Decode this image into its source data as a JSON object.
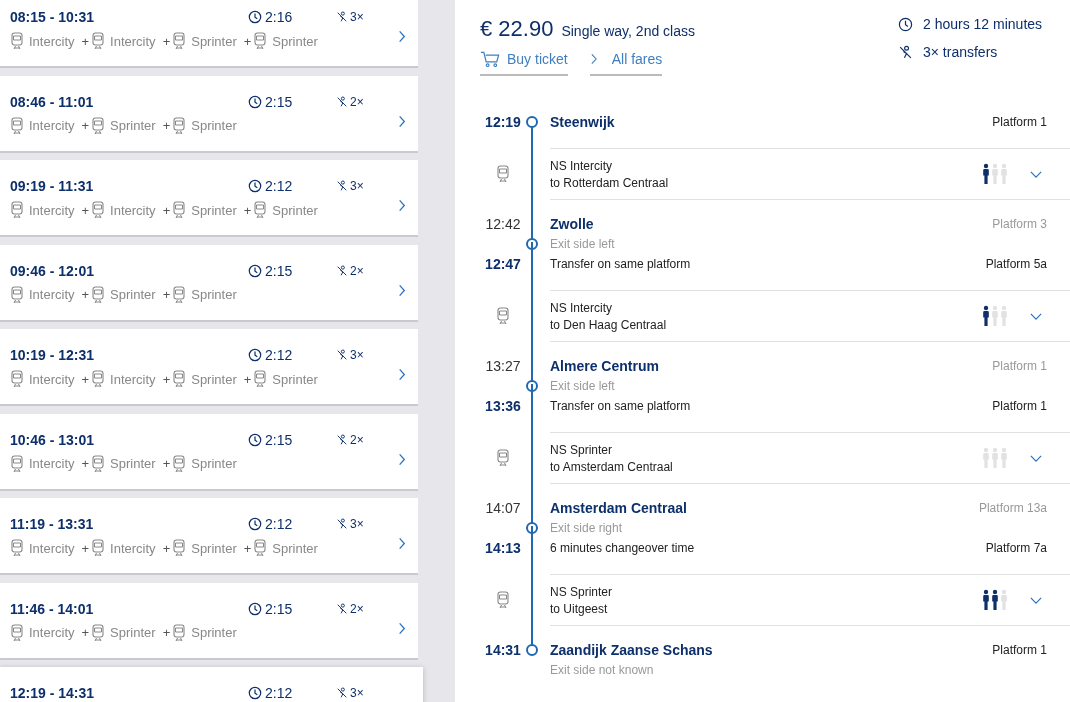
{
  "journeys": [
    {
      "time": "08:15 - 10:31",
      "duration": "2:16",
      "transfers": "3×",
      "selected": false,
      "trains": [
        {
          "name": "Intercity"
        },
        {
          "prefix": "+",
          "name": "Intercity"
        },
        {
          "prefix": "+",
          "name": "Sprinter"
        },
        {
          "prefix": "+",
          "name": "Sprinter"
        }
      ]
    },
    {
      "time": "08:46 - 11:01",
      "duration": "2:15",
      "transfers": "2×",
      "selected": false,
      "trains": [
        {
          "name": "Intercity"
        },
        {
          "prefix": "+",
          "name": "Sprinter"
        },
        {
          "prefix": "+",
          "name": "Sprinter"
        }
      ]
    },
    {
      "time": "09:19 - 11:31",
      "duration": "2:12",
      "transfers": "3×",
      "selected": false,
      "trains": [
        {
          "name": "Intercity"
        },
        {
          "prefix": "+",
          "name": "Intercity"
        },
        {
          "prefix": "+",
          "name": "Sprinter"
        },
        {
          "prefix": "+",
          "name": "Sprinter"
        }
      ]
    },
    {
      "time": "09:46 - 12:01",
      "duration": "2:15",
      "transfers": "2×",
      "selected": false,
      "trains": [
        {
          "name": "Intercity"
        },
        {
          "prefix": "+",
          "name": "Sprinter"
        },
        {
          "prefix": "+",
          "name": "Sprinter"
        }
      ]
    },
    {
      "time": "10:19 - 12:31",
      "duration": "2:12",
      "transfers": "3×",
      "selected": false,
      "trains": [
        {
          "name": "Intercity"
        },
        {
          "prefix": "+",
          "name": "Intercity"
        },
        {
          "prefix": "+",
          "name": "Sprinter"
        },
        {
          "prefix": "+",
          "name": "Sprinter"
        }
      ]
    },
    {
      "time": "10:46 - 13:01",
      "duration": "2:15",
      "transfers": "2×",
      "selected": false,
      "trains": [
        {
          "name": "Intercity"
        },
        {
          "prefix": "+",
          "name": "Sprinter"
        },
        {
          "prefix": "+",
          "name": "Sprinter"
        }
      ]
    },
    {
      "time": "11:19 - 13:31",
      "duration": "2:12",
      "transfers": "3×",
      "selected": false,
      "trains": [
        {
          "name": "Intercity"
        },
        {
          "prefix": "+",
          "name": "Intercity"
        },
        {
          "prefix": "+",
          "name": "Sprinter"
        },
        {
          "prefix": "+",
          "name": "Sprinter"
        }
      ]
    },
    {
      "time": "11:46 - 14:01",
      "duration": "2:15",
      "transfers": "2×",
      "selected": false,
      "trains": [
        {
          "name": "Intercity"
        },
        {
          "prefix": "+",
          "name": "Sprinter"
        },
        {
          "prefix": "+",
          "name": "Sprinter"
        }
      ]
    },
    {
      "time": "12:19 - 14:31",
      "duration": "2:12",
      "transfers": "3×",
      "selected": true
    }
  ],
  "detail": {
    "price": "€ 22.90",
    "fare_type": "Single way, 2nd class",
    "duration": "2 hours 12 minutes",
    "transfers": "3× transfers",
    "buy_link": "Buy ticket",
    "fares_link": "All fares",
    "route": [
      {
        "kind": "stop",
        "rows": [
          {
            "kind": "name",
            "time": "12:19",
            "text": "Steenwijk",
            "platform": "Platform 1",
            "emphasized": true
          }
        ]
      },
      {
        "kind": "leg",
        "train": "NS Intercity",
        "destination": "to Rotterdam Centraal",
        "occupancy": [
          {
            "filled": true
          },
          {
            "filled": false
          },
          {
            "filled": false
          }
        ]
      },
      {
        "kind": "stop",
        "rows": [
          {
            "kind": "name",
            "time": "12:42",
            "text": "Zwolle",
            "platform": "Platform 3",
            "emphasized": false
          },
          {
            "kind": "exit",
            "text": "Exit side left"
          },
          {
            "kind": "transfer",
            "time": "12:47",
            "text": "Transfer on same platform",
            "platform": "Platform 5a",
            "emphasized": true
          }
        ]
      },
      {
        "kind": "leg",
        "train": "NS Intercity",
        "destination": "to Den Haag Centraal",
        "occupancy": [
          {
            "filled": true
          },
          {
            "filled": false
          },
          {
            "filled": false
          }
        ]
      },
      {
        "kind": "stop",
        "rows": [
          {
            "kind": "name",
            "time": "13:27",
            "text": "Almere Centrum",
            "platform": "Platform 1",
            "emphasized": false
          },
          {
            "kind": "exit",
            "text": "Exit side left"
          },
          {
            "kind": "transfer",
            "time": "13:36",
            "text": "Transfer on same platform",
            "platform": "Platform 1",
            "emphasized": true
          }
        ]
      },
      {
        "kind": "leg",
        "train": "NS Sprinter",
        "destination": "to Amsterdam Centraal",
        "occupancy": [
          {
            "filled": false
          },
          {
            "filled": false
          },
          {
            "filled": false
          }
        ]
      },
      {
        "kind": "stop",
        "rows": [
          {
            "kind": "name",
            "time": "14:07",
            "text": "Amsterdam Centraal",
            "platform": "Platform 13a",
            "emphasized": false
          },
          {
            "kind": "exit",
            "text": "Exit side right"
          },
          {
            "kind": "transfer",
            "time": "14:13",
            "text": "6 minutes changeover time",
            "platform": "Platform 7a",
            "emphasized": true
          }
        ]
      },
      {
        "kind": "leg",
        "train": "NS Sprinter",
        "destination": "to Uitgeest",
        "occupancy": [
          {
            "filled": true
          },
          {
            "filled": true
          },
          {
            "filled": false
          }
        ]
      },
      {
        "kind": "stop",
        "rows": [
          {
            "kind": "name",
            "time": "14:31",
            "text": "Zaandijk Zaanse Schans",
            "platform": "Platform 1",
            "emphasized": true
          },
          {
            "kind": "exit",
            "text": "Exit side not known"
          }
        ]
      }
    ]
  }
}
